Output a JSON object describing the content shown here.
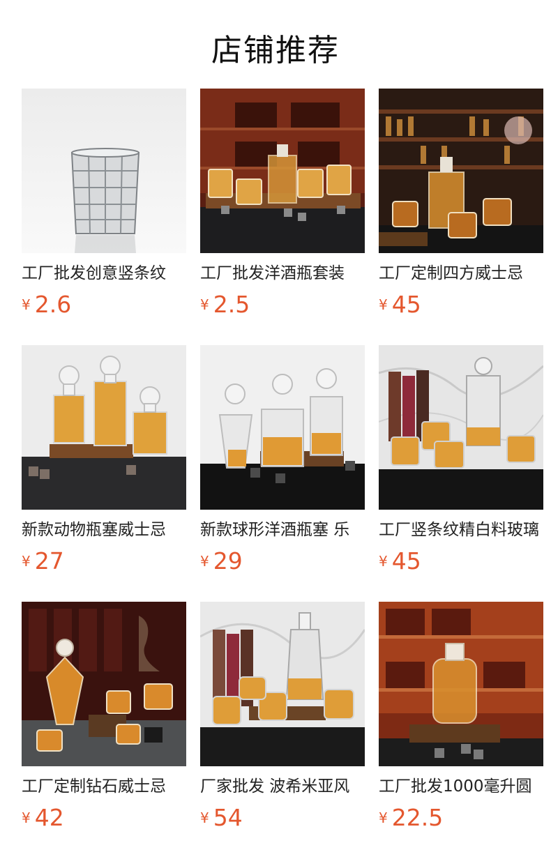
{
  "section_title": "店铺推荐",
  "currency_symbol": "¥",
  "colors": {
    "price": "#e4572e",
    "title": "#111111"
  },
  "products": [
    {
      "name": "工厂批发创意竖条纹",
      "price": "2.6",
      "image": "cut-crystal-whisky-glass"
    },
    {
      "name": "工厂批发洋酒瓶套装",
      "price": "2.5",
      "image": "decanter-set-wood-library"
    },
    {
      "name": "工厂定制四方威士忌",
      "price": "45",
      "image": "square-decanter-bar"
    },
    {
      "name": "新款动物瓶塞威士忌",
      "price": "27",
      "image": "animal-stopper-decanters"
    },
    {
      "name": "新款球形洋酒瓶塞 乐",
      "price": "29",
      "image": "globe-stopper-decanters"
    },
    {
      "name": "工厂竖条纹精白料玻璃",
      "price": "45",
      "image": "ribbed-decanter-marble"
    },
    {
      "name": "工厂定制钻石威士忌",
      "price": "42",
      "image": "diamond-decanter-set"
    },
    {
      "name": "厂家批发 波希米亚风",
      "price": "54",
      "image": "bohemian-decanter-marble"
    },
    {
      "name": "工厂批发1000毫升圆",
      "price": "22.5",
      "image": "round-1000ml-decanter"
    }
  ]
}
